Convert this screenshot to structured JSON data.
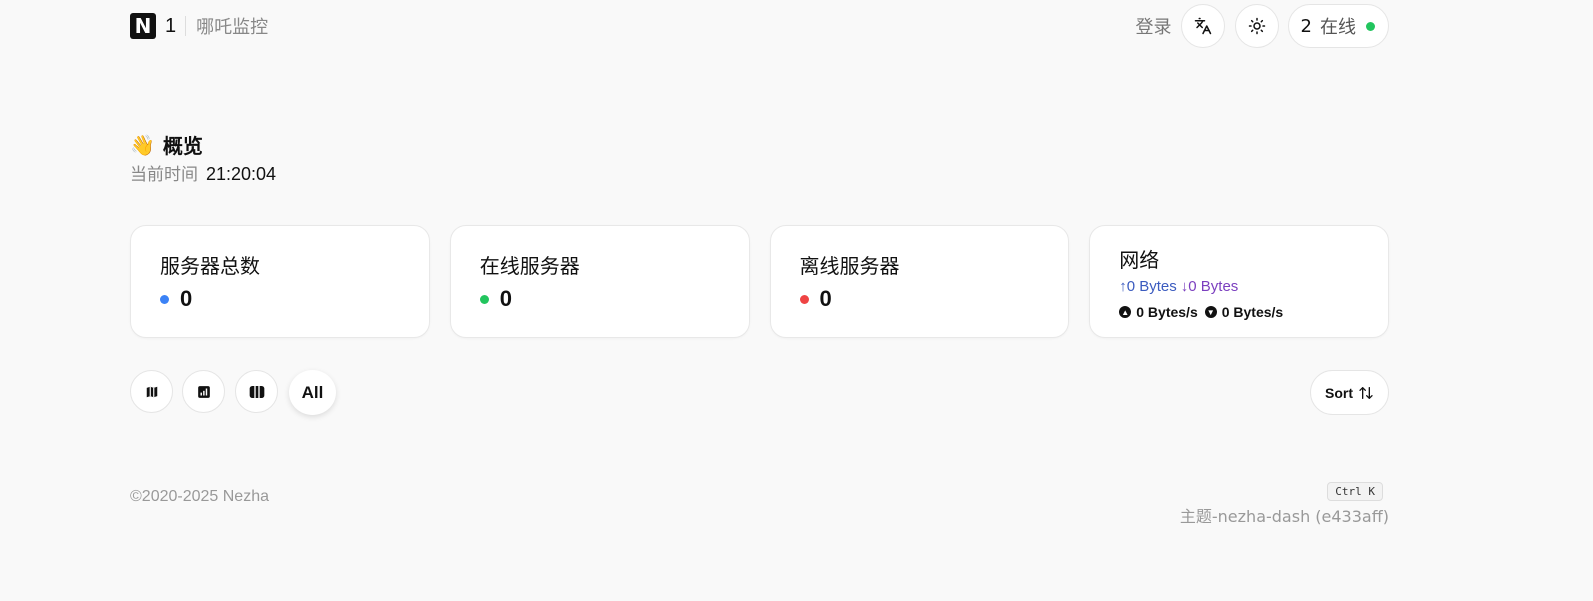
{
  "header": {
    "logo_letter": "N",
    "logo_number": "1",
    "site_name": "哪吒监控",
    "login_label": "登录",
    "online_count": "2",
    "online_label": "在线"
  },
  "overview": {
    "emoji": "👋",
    "title": "概览",
    "time_label": "当前时间",
    "time_value": "21:20:04"
  },
  "cards": {
    "total": {
      "title": "服务器总数",
      "value": "0",
      "dot_color": "#3b82f6"
    },
    "online": {
      "title": "在线服务器",
      "value": "0",
      "dot_color": "#22c55e"
    },
    "offline": {
      "title": "离线服务器",
      "value": "0",
      "dot_color": "#ef4444"
    },
    "network": {
      "title": "网络",
      "upload_total": "↑0 Bytes",
      "download_total": "↓0 Bytes",
      "upload_speed": "0 Bytes/s",
      "download_speed": "0 Bytes/s"
    }
  },
  "toolbar": {
    "icons": [
      "map-icon",
      "chart-icon",
      "columns-icon"
    ],
    "all_label": "All",
    "sort_label": "Sort"
  },
  "footer": {
    "copyright": "©2020-2025 Nezha",
    "shortcut": "Ctrl K",
    "theme": "主题-nezha-dash (e433aff)"
  }
}
